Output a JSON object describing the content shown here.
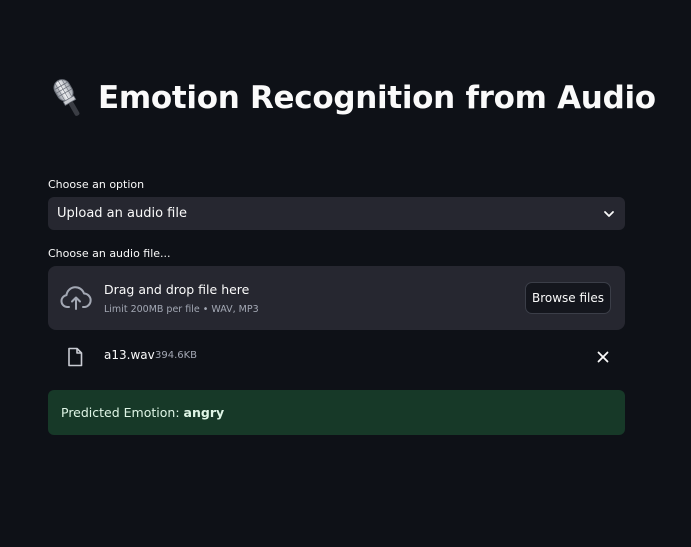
{
  "header": {
    "title": "Emotion Recognition from Audio",
    "title_icon": "microphone-icon"
  },
  "option_select": {
    "label": "Choose an option",
    "selected": "Upload an audio file",
    "icon": "chevron-down-icon"
  },
  "uploader": {
    "label": "Choose an audio file...",
    "drop_title": "Drag and drop file here",
    "drop_subtitle": "Limit 200MB per file • WAV, MP3",
    "browse_label": "Browse files",
    "icon": "cloud-upload-icon"
  },
  "uploaded_file": {
    "name": "a13.wav",
    "size": "394.6KB",
    "file_icon": "file-icon",
    "remove_icon": "close-icon"
  },
  "result": {
    "label": "Predicted Emotion:",
    "value": "angry"
  },
  "colors": {
    "background": "#0e1117",
    "widget": "#262730",
    "success_bg": "#173928",
    "text": "#fafafa",
    "muted": "#a3a8b4"
  }
}
